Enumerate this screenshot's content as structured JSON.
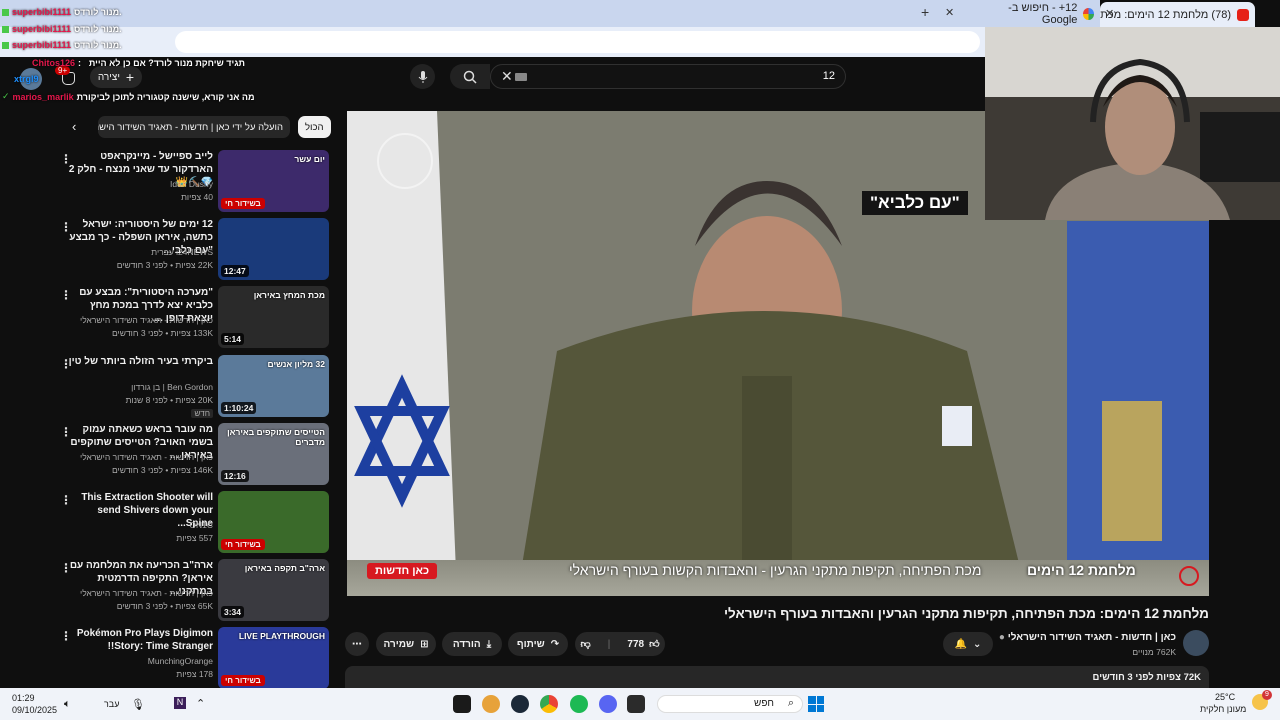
{
  "browser": {
    "tabs": [
      {
        "title": "(78) מלחמת 12 הימים: מכת"
      },
      {
        "title": "12+ - חיפוש ב-Google"
      }
    ],
    "new_tab_icon": "plus-icon"
  },
  "chat": {
    "lines": [
      {
        "user": "superbibi1111",
        "text": "מנור לורדס.",
        "color": "#e4184c"
      },
      {
        "user": "superbibi1111",
        "text": "מנור לורדס.",
        "color": "#e4184c"
      },
      {
        "user": "superbibi1111",
        "text": "מנור לורדס.",
        "color": "#e4184c"
      },
      {
        "user": "",
        "text": "תגיד שיחקת מנור לורד? אם כן לא היית",
        "color": "#ffffff"
      },
      {
        "user": "Chitos126",
        "text": ":",
        "color": "#e4184c"
      },
      {
        "user": "xtrgl9",
        "text": "",
        "color": "#1e90ff"
      },
      {
        "user": "marios_marlik",
        "text": "מה אני קורא, שישנה קטגוריה לתוכן לביקורת",
        "color": "#e4184c"
      }
    ],
    "notif_count": "9+"
  },
  "youtube": {
    "search_value": "12",
    "create_label": "יצירה",
    "chips": [
      "הכול",
      "הועלה על ידי כאן | חדשות - תאגיד השידור הישראלי"
    ],
    "recommendations": [
      {
        "title": "לייב ספיישל - מיינקראפט הארדקור עד שאני מנצח - חלק 2 💎⛏️👑",
        "channel": "Idan Dushy",
        "meta": "40 צפיות",
        "duration": "",
        "live": "בשידור חי",
        "thumb_text": "יום עשר"
      },
      {
        "title": "12 ימים של היסטוריה: ישראל כתשה, איראן השפלה - כך מבצע \"עם כלבי...",
        "channel": "i24NEWS עברית",
        "meta": "22K צפיות • לפני 3 חודשים",
        "duration": "12:47",
        "live": "",
        "thumb_text": ""
      },
      {
        "title": "\"מערכה היסטורית\": מבצע עם כלביא יצא לדרך במכת מחץ יוצאת דופן ...",
        "channel": "כאן | חדשות - תאגיד השידור הישראלי",
        "meta": "133K צפיות • לפני 3 חודשים",
        "duration": "5:14",
        "live": "",
        "thumb_text": "מכת המחץ באיראן"
      },
      {
        "title": "ביקרתי בעיר הזולה ביותר של טין",
        "channel": "Ben Gordon | בן גורדון",
        "meta": "20K צפיות • לפני 8 שנות",
        "duration": "1:10:24",
        "live": "",
        "badge": "חדש",
        "thumb_text": "32 מליון אנשים"
      },
      {
        "title": "מה עובר בראש כשאתה עמוק בשמי האויב? הטייסים שתוקפים באיראן ...",
        "channel": "כאן | חדשות - תאגיד השידור הישראלי",
        "meta": "146K צפיות • לפני 3 חודשים",
        "duration": "12:16",
        "live": "",
        "thumb_text": "הטייסים שתוקפים באיראן מדברים"
      },
      {
        "title": "This Extraction Shooter will send Shivers down your Spine...",
        "channel": "ON1C",
        "meta": "557 צפיות",
        "duration": "",
        "live": "בשידור חי",
        "thumb_text": ""
      },
      {
        "title": "ארה\"ב הכריעה את המלחמה עם איראן? התקיפה הדרמטית במתקני...",
        "channel": "כאן | חדשות - תאגיד השידור הישראלי",
        "meta": "65K צפיות • לפני 3 חודשים",
        "duration": "3:34",
        "live": "",
        "thumb_text": "ארה\"ב תקפה באיראן"
      },
      {
        "title": "Pokémon Pro Plays Digimon Story: Time Stranger!!",
        "channel": "MunchingOrange",
        "meta": "178 צפיות",
        "duration": "",
        "live": "בשידור חי",
        "thumb_text": "LIVE PLAYTHROUGH"
      }
    ],
    "video": {
      "banner_left": "כאן חדשות",
      "banner_main": "מכת הפתיחה, תקיפות מתקני הגרעין - והאבדות הקשות בעורף הישראלי",
      "banner_tag": "מלחמת 12 הימים",
      "quote": "\"עם כלביא\""
    },
    "title": "מלחמת 12 הימים: מכת הפתיחה, תקיפות מתקני הגרעין והאבדות בעורף הישראלי",
    "channel_name": "כאן | חדשות - תאגיד השידור הישראלי",
    "subscribers": "762K מנויים",
    "likes": "778",
    "share_label": "שיתוף",
    "download_label": "הורדה",
    "save_label": "שמירה",
    "views_line": "72K צפיות  לפני 3 חודשים",
    "red_line": "#ff0033"
  },
  "taskbar": {
    "time": "01:29",
    "date": "09/10/2025",
    "lang": "עבר",
    "search_label": "חפש",
    "weather_temp": "25°C",
    "weather_desc": "מעונן חלקית",
    "weather_badge": "9"
  }
}
